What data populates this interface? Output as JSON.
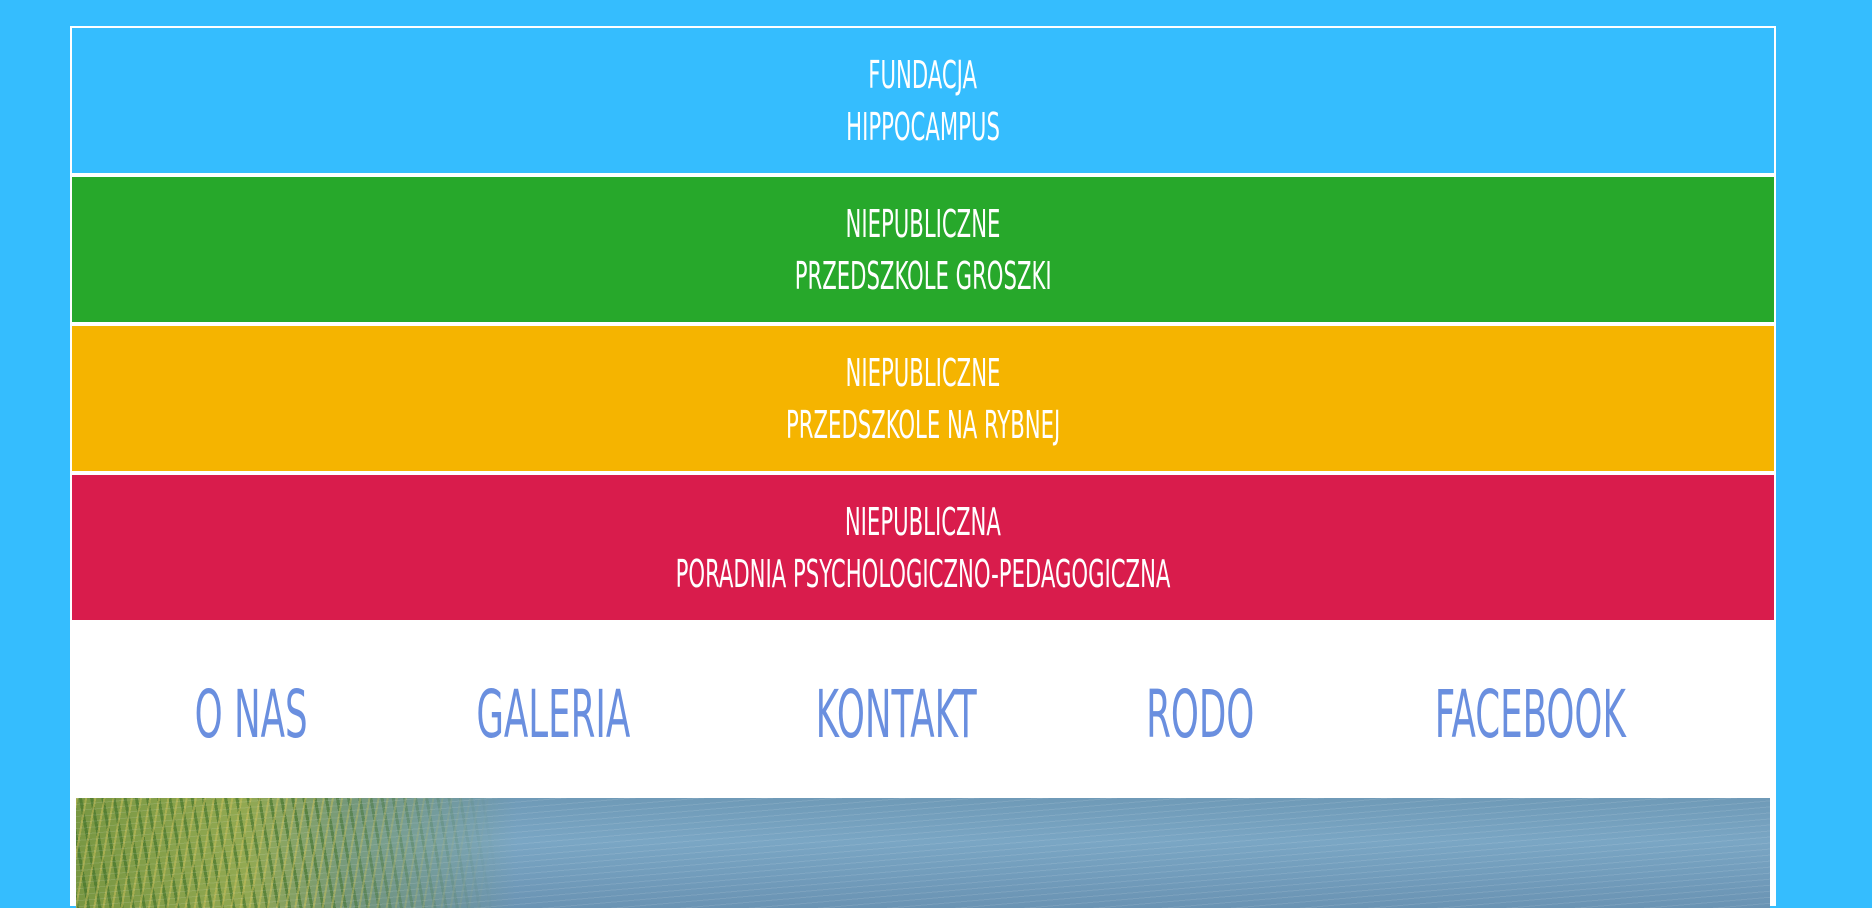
{
  "bands": [
    {
      "line1": "FUNDACJA",
      "line2": "HIPPOCAMPUS",
      "color": "#35bdfe"
    },
    {
      "line1": "NIEPUBLICZNE",
      "line2": "PRZEDSZKOLE GROSZKI",
      "color": "#27a82b"
    },
    {
      "line1": "NIEPUBLICZNE",
      "line2": "PRZEDSZKOLE NA RYBNEJ",
      "color": "#f5b400"
    },
    {
      "line1": "NIEPUBLICZNA",
      "line2": "PORADNIA PSYCHOLOGICZNO-PEDAGOGICZNA",
      "color": "#d91c4c"
    }
  ],
  "nav": {
    "items": [
      "O NAS",
      "GALERIA",
      "KONTAKT",
      "RODO",
      "FACEBOOK"
    ],
    "color": "#6a8fdf"
  },
  "page": {
    "background": "#35bdfe"
  }
}
